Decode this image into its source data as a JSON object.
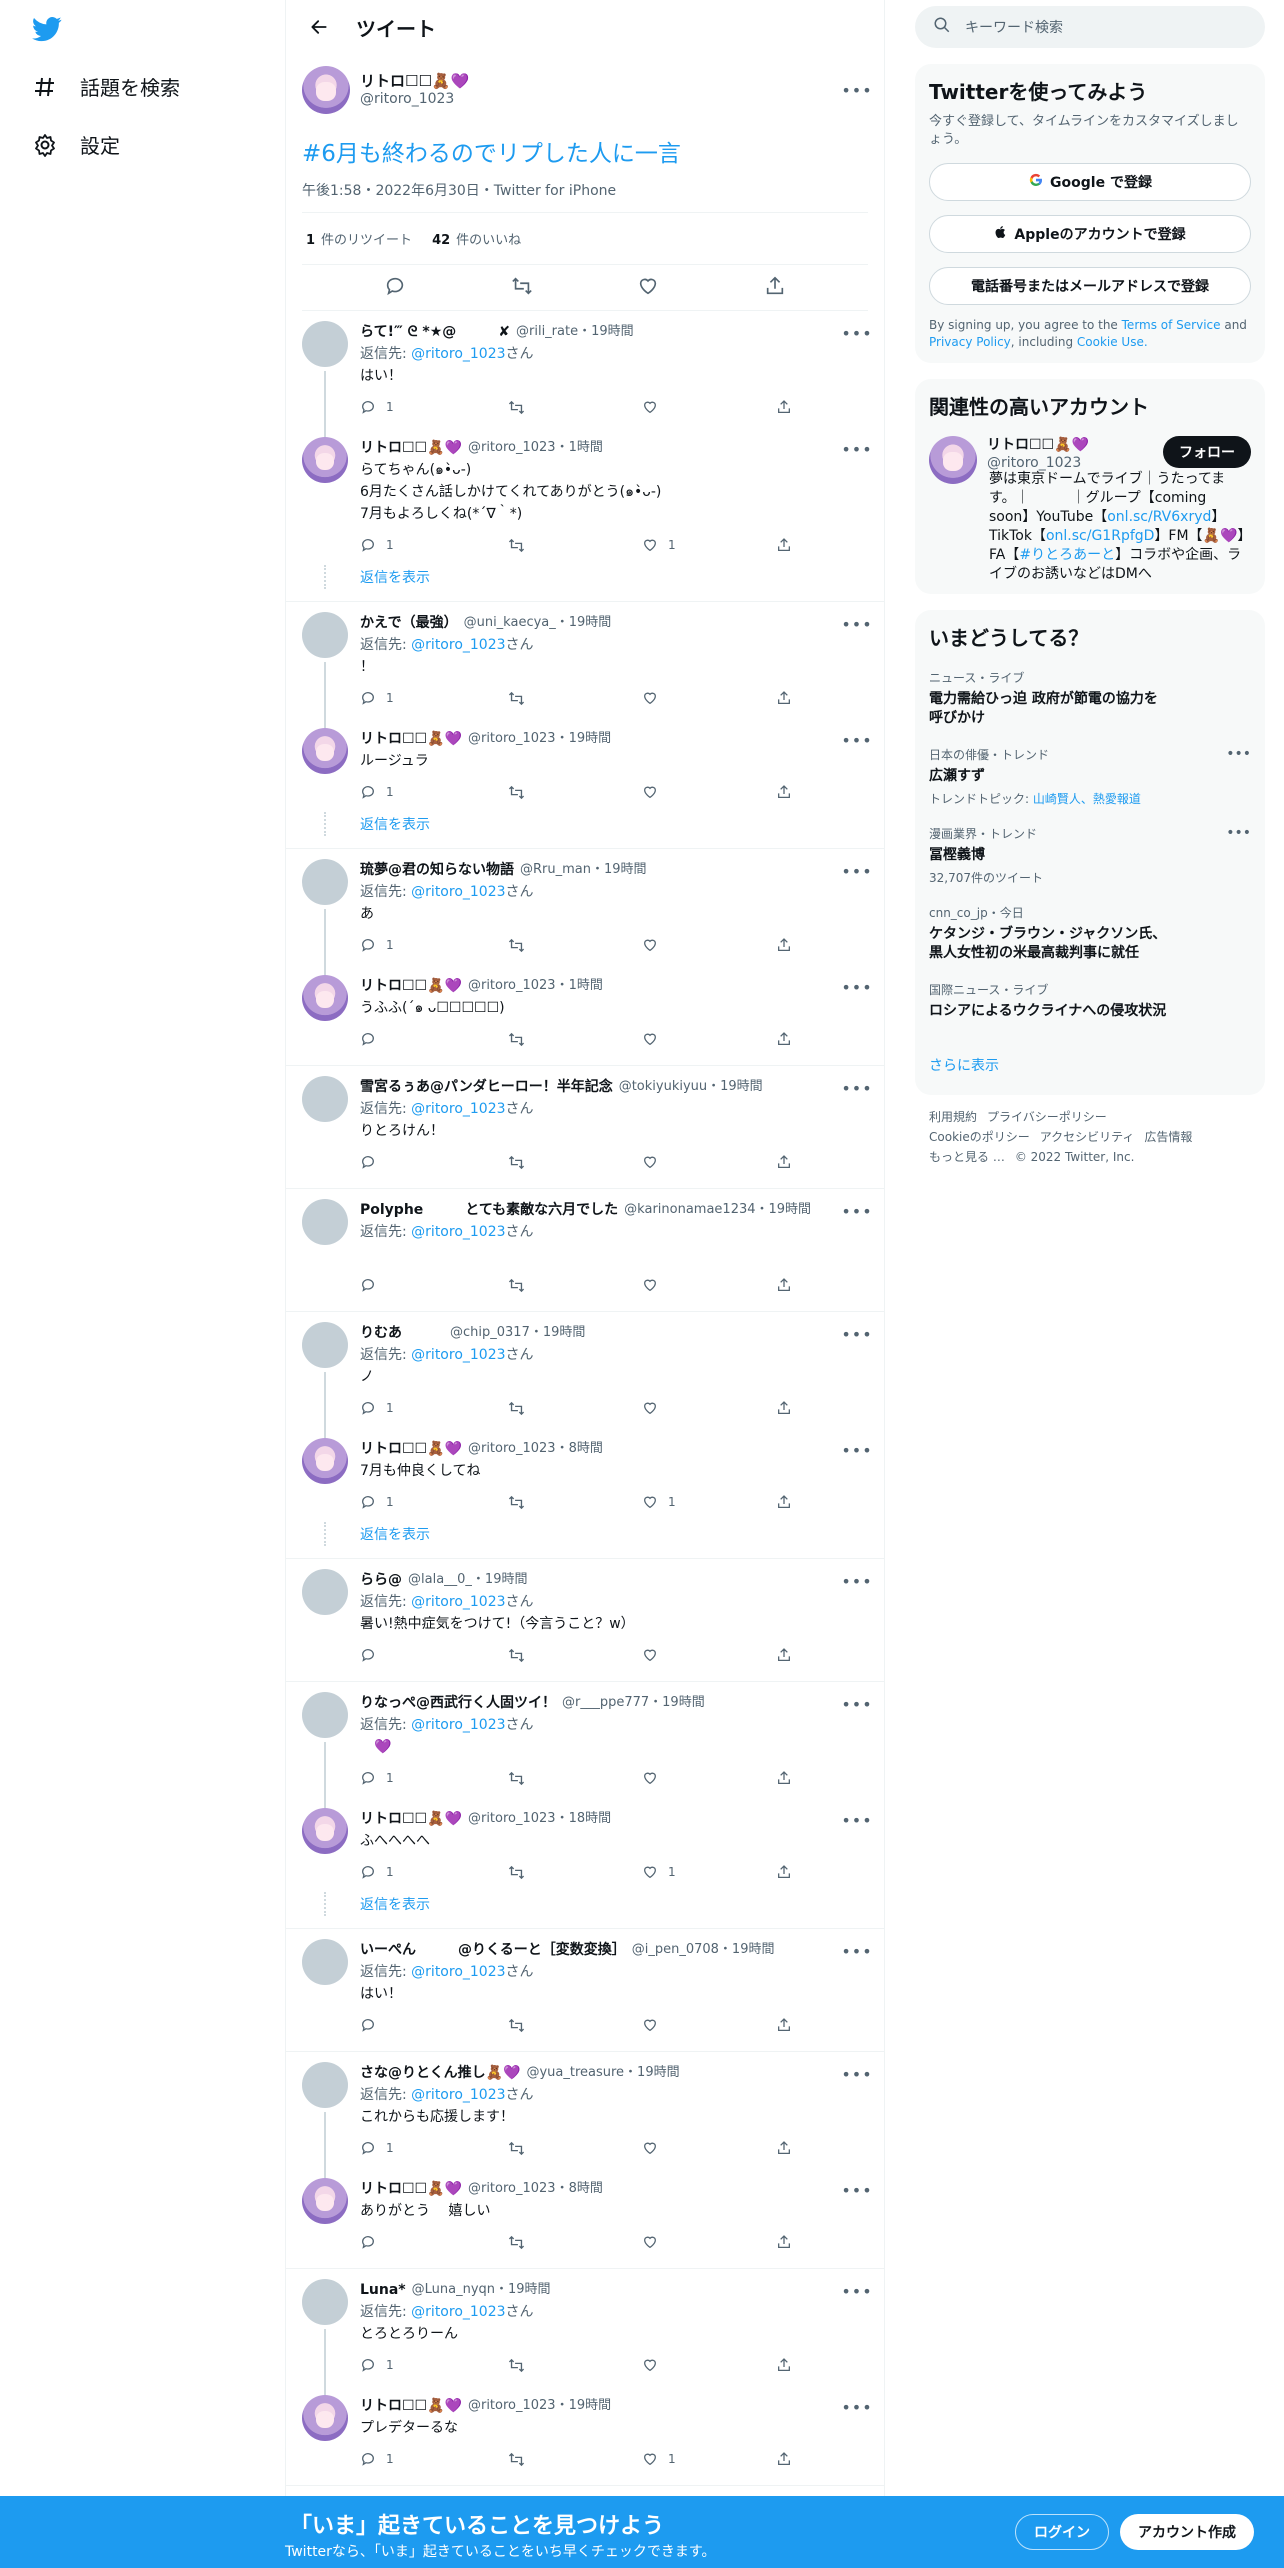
{
  "nav": {
    "explore": "話題を検索",
    "settings": "設定"
  },
  "header": {
    "title": "ツイート"
  },
  "main_tweet": {
    "name": "リトロ☐☐🧸💜",
    "handle": "@ritoro_1023",
    "text": "#6月も終わるのでリプした人に一言",
    "time": "午後1:58・2022年6月30日・Twitter for iPhone",
    "retweets_count": "1",
    "retweets_label": "件のリツイート",
    "likes_count": "42",
    "likes_label": "件のいいね"
  },
  "groups": [
    {
      "tweets": [
        {
          "avatar": "gray",
          "name": "らて!‴ ᘓ *★@　　　✘",
          "handle": "@rili_rate・19時間",
          "reply_to": "@ritoro_1023",
          "text": "はい！",
          "reply_count": "1",
          "like_count": ""
        },
        {
          "avatar": "purple",
          "name": "リトロ☐☐🧸💜",
          "handle": "@ritoro_1023・1時間",
          "reply_to": "",
          "text": "らてちゃん(๑•̀ᴗ-)\n6月たくさん話しかけてくれてありがとう(๑•̀ᴗ-)\n7月もよろしくね(*´∇｀*)",
          "reply_count": "1",
          "like_count": "1"
        }
      ],
      "show_replies": "返信を表示"
    },
    {
      "tweets": [
        {
          "avatar": "gray",
          "name": "かえで（最強）",
          "handle": "@uni_kaecya_・19時間",
          "reply_to": "@ritoro_1023",
          "text": "！",
          "reply_count": "1",
          "like_count": ""
        },
        {
          "avatar": "purple",
          "name": "リトロ☐☐🧸💜",
          "handle": "@ritoro_1023・19時間",
          "reply_to": "",
          "text": "ルージュラ",
          "reply_count": "1",
          "like_count": ""
        }
      ],
      "show_replies": "返信を表示"
    },
    {
      "tweets": [
        {
          "avatar": "gray",
          "name": "琉夢@君の知らない物語",
          "handle": "@Rru_man・19時間",
          "reply_to": "@ritoro_1023",
          "text": "あ",
          "reply_count": "1",
          "like_count": ""
        },
        {
          "avatar": "purple",
          "name": "リトロ☐☐🧸💜",
          "handle": "@ritoro_1023・1時間",
          "reply_to": "",
          "text": "うふふ(´๑ ᴗ☐☐☐☐☐)",
          "reply_count": "",
          "like_count": ""
        }
      ],
      "show_replies": ""
    },
    {
      "tweets": [
        {
          "avatar": "gray",
          "name": "雪宮るぅあ@パンダヒーロー！半年記念",
          "handle": "@tokiyukiyuu・19時間",
          "reply_to": "@ritoro_1023",
          "text": "りとろけん！",
          "reply_count": "",
          "like_count": ""
        }
      ],
      "show_replies": ""
    },
    {
      "tweets": [
        {
          "avatar": "gray",
          "name": "Polyphe　　　とても素敵な六月でした",
          "handle": "@karinonamae1234・19時間",
          "reply_to": "@ritoro_1023",
          "text": "",
          "reply_count": "",
          "like_count": ""
        }
      ],
      "show_replies": ""
    },
    {
      "tweets": [
        {
          "avatar": "gray",
          "name": "りむあ　　　",
          "handle": "@chip_0317・19時間",
          "reply_to": "@ritoro_1023",
          "text": "ノ",
          "reply_count": "1",
          "like_count": ""
        },
        {
          "avatar": "purple",
          "name": "リトロ☐☐🧸💜",
          "handle": "@ritoro_1023・8時間",
          "reply_to": "",
          "text": "7月も仲良くしてね",
          "reply_count": "1",
          "like_count": "1"
        }
      ],
      "show_replies": "返信を表示"
    },
    {
      "tweets": [
        {
          "avatar": "gray",
          "name": "らら@",
          "handle": "@lala__0_・19時間",
          "reply_to": "@ritoro_1023",
          "text": "暑い!熱中症気をつけて!（今言うこと？w）",
          "reply_count": "",
          "like_count": ""
        }
      ],
      "show_replies": ""
    },
    {
      "tweets": [
        {
          "avatar": "gray",
          "name": "りなっぺ@西武行く人固ツイ！",
          "handle": "@r___ppe777・19時間",
          "reply_to": "@ritoro_1023",
          "text": "　💜",
          "reply_count": "1",
          "like_count": ""
        },
        {
          "avatar": "purple",
          "name": "リトロ☐☐🧸💜",
          "handle": "@ritoro_1023・18時間",
          "reply_to": "",
          "text": "ふへへへへ",
          "reply_count": "1",
          "like_count": "1"
        }
      ],
      "show_replies": "返信を表示"
    },
    {
      "tweets": [
        {
          "avatar": "gray",
          "name": "いーぺん　　　@りくるーと［変数変換］",
          "handle": "@i_pen_0708・19時間",
          "reply_to": "@ritoro_1023",
          "text": "はい！",
          "reply_count": "",
          "like_count": ""
        }
      ],
      "show_replies": ""
    },
    {
      "tweets": [
        {
          "avatar": "gray",
          "name": "さな@りとくん推し🧸💜",
          "handle": "@yua_treasure・19時間",
          "reply_to": "@ritoro_1023",
          "text": "これからも応援します！",
          "reply_count": "1",
          "like_count": ""
        },
        {
          "avatar": "purple",
          "name": "リトロ☐☐🧸💜",
          "handle": "@ritoro_1023・8時間",
          "reply_to": "",
          "text": "ありがとう　 嬉しい",
          "reply_count": "",
          "like_count": ""
        }
      ],
      "show_replies": ""
    },
    {
      "tweets": [
        {
          "avatar": "gray",
          "name": "Luna*",
          "handle": "@Luna_nyqn・19時間",
          "reply_to": "@ritoro_1023",
          "text": "とろとろりーん",
          "reply_count": "1",
          "like_count": ""
        },
        {
          "avatar": "purple",
          "name": "リトロ☐☐🧸💜",
          "handle": "@ritoro_1023・19時間",
          "reply_to": "",
          "text": "プレデターるな",
          "reply_count": "1",
          "like_count": "1"
        }
      ],
      "show_replies": ""
    }
  ],
  "labels": {
    "reply_prefix": "返信先: ",
    "reply_suffix": "さん"
  },
  "search": {
    "placeholder": "キーワード検索"
  },
  "signup": {
    "title": "Twitterを使ってみよう",
    "subtitle": "今すぐ登録して、タイムラインをカスタマイズしましょう。",
    "google": "Google で登録",
    "apple": "Appleのアカウントで登録",
    "phone": "電話番号またはメールアドレスで登録",
    "terms_1": "By signing up, you agree to the ",
    "terms_link1": "Terms of Service",
    "terms_2": " and ",
    "terms_link2": "Privacy Policy",
    "terms_3": ", including ",
    "terms_link3": "Cookie Use."
  },
  "related": {
    "title": "関連性の高いアカウント",
    "name": "リトロ☐☐🧸💜",
    "handle": "@ritoro_1023",
    "follow": "フォロー",
    "bio_1": "夢は東京ドームでライブ｜うたってます。｜　　　｜グループ【coming soon】YouTube【",
    "bio_link1": "onl.sc/RV6xryd",
    "bio_2": "】TikTok【",
    "bio_link2": "onl.sc/G1RpfgD",
    "bio_3": "】FM【🧸💜】FA【",
    "bio_link3": "#りとろあーと",
    "bio_4": "】コラボや企画、ライブのお誘いなどはDMへ"
  },
  "trends": {
    "title": "いまどうしてる？",
    "items": [
      {
        "category": "ニュース・ライブ",
        "title": "電力需給ひっ迫 政府が節電の協力を呼びかけ",
        "sub_prefix": "",
        "sub_links": "",
        "has_more": false
      },
      {
        "category": "日本の俳優・トレンド",
        "title": "広瀬すず",
        "sub_prefix": "トレンドトピック: ",
        "sub_links": "山崎賢人、熱愛報道",
        "has_more": true
      },
      {
        "category": "漫画業界・トレンド",
        "title": "冨樫義博",
        "sub_prefix": "32,707件のツイート",
        "sub_links": "",
        "has_more": true
      },
      {
        "category": "cnn_co_jp・今日",
        "title": "ケタンジ・ブラウン・ジャクソン氏、黒人女性初の米最高裁判事に就任",
        "sub_prefix": "",
        "sub_links": "",
        "has_more": false
      },
      {
        "category": "国際ニュース・ライブ",
        "title": "ロシアによるウクライナへの侵攻状況",
        "sub_prefix": "",
        "sub_links": "",
        "has_more": false
      }
    ],
    "show_more": "さらに表示"
  },
  "footer": {
    "links": [
      "利用規約",
      "プライバシーポリシー",
      "Cookieのポリシー",
      "アクセシビリティ",
      "広告情報",
      "もっと見る …",
      "© 2022 Twitter, Inc."
    ]
  },
  "bottom_bar": {
    "title": "「いま」起きていることを見つけよう",
    "subtitle": "Twitterなら、「いま」起きていることをいち早くチェックできます。",
    "login": "ログイン",
    "signup": "アカウント作成"
  },
  "colors": {
    "accent": "#1d9bf0",
    "text": "#0f1419",
    "muted": "#536471"
  }
}
